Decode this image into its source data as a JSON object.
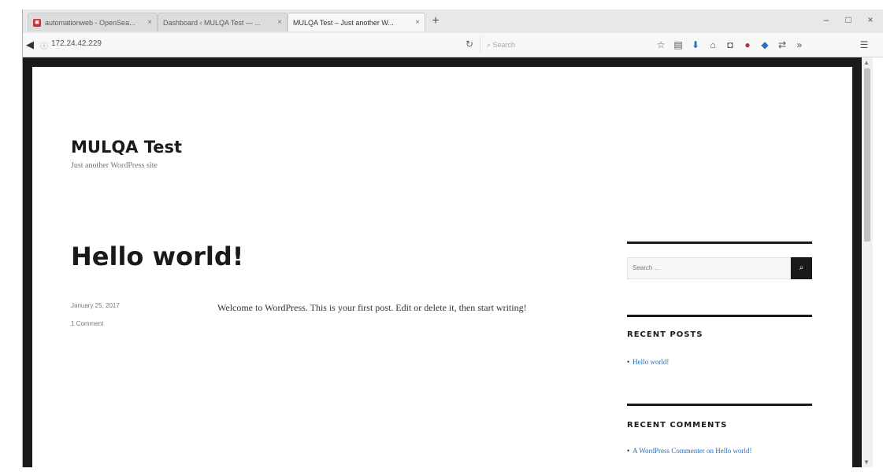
{
  "browser": {
    "tabs": [
      {
        "label": "automationweb - OpenSea...",
        "favicon": "red-square"
      },
      {
        "label": "Dashboard ‹ MULQA Test — ...",
        "favicon": ""
      },
      {
        "label": "MULQA Test – Just another W...",
        "favicon": ""
      }
    ],
    "new_tab": "+",
    "url": "172.24.42.229",
    "search_placeholder": "Search",
    "window_controls": {
      "minimize": "–",
      "maximize": "□",
      "close": "×"
    }
  },
  "site": {
    "title": "MULQA Test",
    "description": "Just another WordPress site"
  },
  "post": {
    "title": "Hello world!",
    "date": "January 25, 2017",
    "comments": "1 Comment",
    "content": "Welcome to WordPress. This is your first post. Edit or delete it, then start writing!"
  },
  "sidebar": {
    "search_placeholder": "Search …",
    "recent_posts_title": "RECENT POSTS",
    "recent_posts": [
      "Hello world!"
    ],
    "recent_comments_title": "RECENT COMMENTS",
    "recent_comment": "A WordPress Commenter on Hello world!"
  },
  "colors": {
    "frame": "#1a1a1a",
    "link": "#2b6cbe"
  }
}
